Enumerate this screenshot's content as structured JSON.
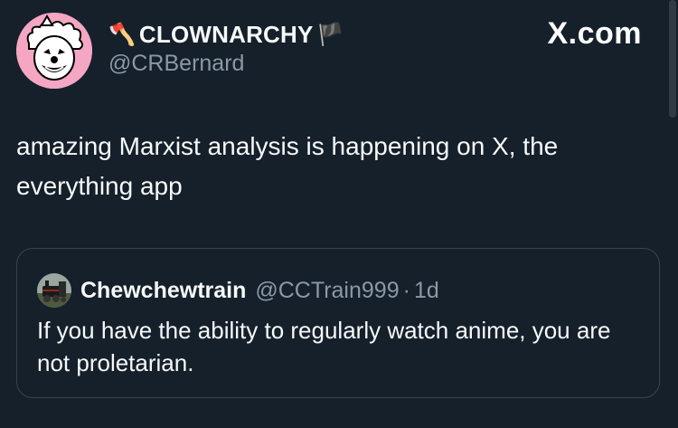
{
  "site_label": "X.com",
  "author": {
    "display_name": "CLOWNARCHY",
    "name_prefix_emoji": "🪓",
    "name_suffix_emoji": "🏴",
    "handle": "@CRBernard",
    "avatar_icon": "clown-face-avatar"
  },
  "tweet": {
    "text": "amazing Marxist analysis is happening on X, the everything app"
  },
  "quoted_tweet": {
    "display_name": "Chewchewtrain",
    "handle": "@CCTrain999",
    "separator": "·",
    "time": "1d",
    "avatar_icon": "steam-train-avatar",
    "text": "If you have the ability to regularly watch anime, you are not proletarian."
  },
  "colors": {
    "background": "#15202b",
    "primary_text": "#f7f9f9",
    "secondary_text": "#8b98a5",
    "border": "#38444d",
    "avatar_bg": "#f4a6c2"
  }
}
